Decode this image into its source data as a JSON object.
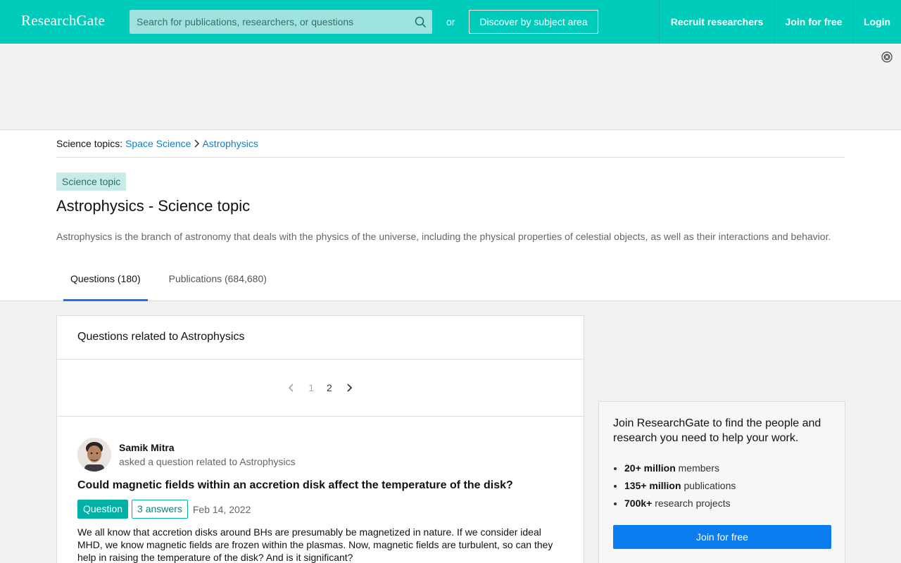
{
  "header": {
    "logo": "ResearchGate",
    "search_placeholder": "Search for publications, researchers, or questions",
    "or_label": "or",
    "discover_label": "Discover by subject area",
    "recruit_label": "Recruit researchers",
    "join_label": "Join for free",
    "login_label": "Login",
    "color": "#00ccbb"
  },
  "breadcrumb": {
    "prefix": "Science topics:",
    "items": [
      "Space Science",
      "Astrophysics"
    ]
  },
  "topic": {
    "badge": "Science topic",
    "title": "Astrophysics - Science topic",
    "description": "Astrophysics is the branch of astronomy that deals with the physics of the universe, including the physical properties of celestial objects, as well as their interactions and behavior."
  },
  "tabs": [
    {
      "label": "Questions (180)",
      "active": true
    },
    {
      "label": "Publications (684,680)",
      "active": false
    }
  ],
  "questions_card": {
    "heading": "Questions related to Astrophysics",
    "pager": {
      "pages": [
        "1",
        "2"
      ],
      "current": "2"
    },
    "question": {
      "author": "Samik Mitra",
      "asked": "asked a question related to Astrophysics",
      "title": "Could magnetic fields within an accretion disk affect the temperature of the disk?",
      "type_tag": "Question",
      "answers": "3 answers",
      "date": "Feb 14, 2022",
      "body": "We all know that accretion disks around BHs are presumably be magnetized in nature. If we consider ideal MHD, we know magnetic fields are frozen within the plasmas. Now, magnetic fields are turbulent, so can they help in raising the temperature of the disk? And is it significant?"
    }
  },
  "side_card": {
    "heading": "Join ResearchGate to find the people and research you need to help your work.",
    "stats": [
      {
        "value": "20+ million",
        "label": "members"
      },
      {
        "value": "135+ million",
        "label": "publications"
      },
      {
        "value": "700k+",
        "label": "research projects"
      }
    ],
    "button": "Join for free",
    "button_color": "#0a7df0"
  }
}
